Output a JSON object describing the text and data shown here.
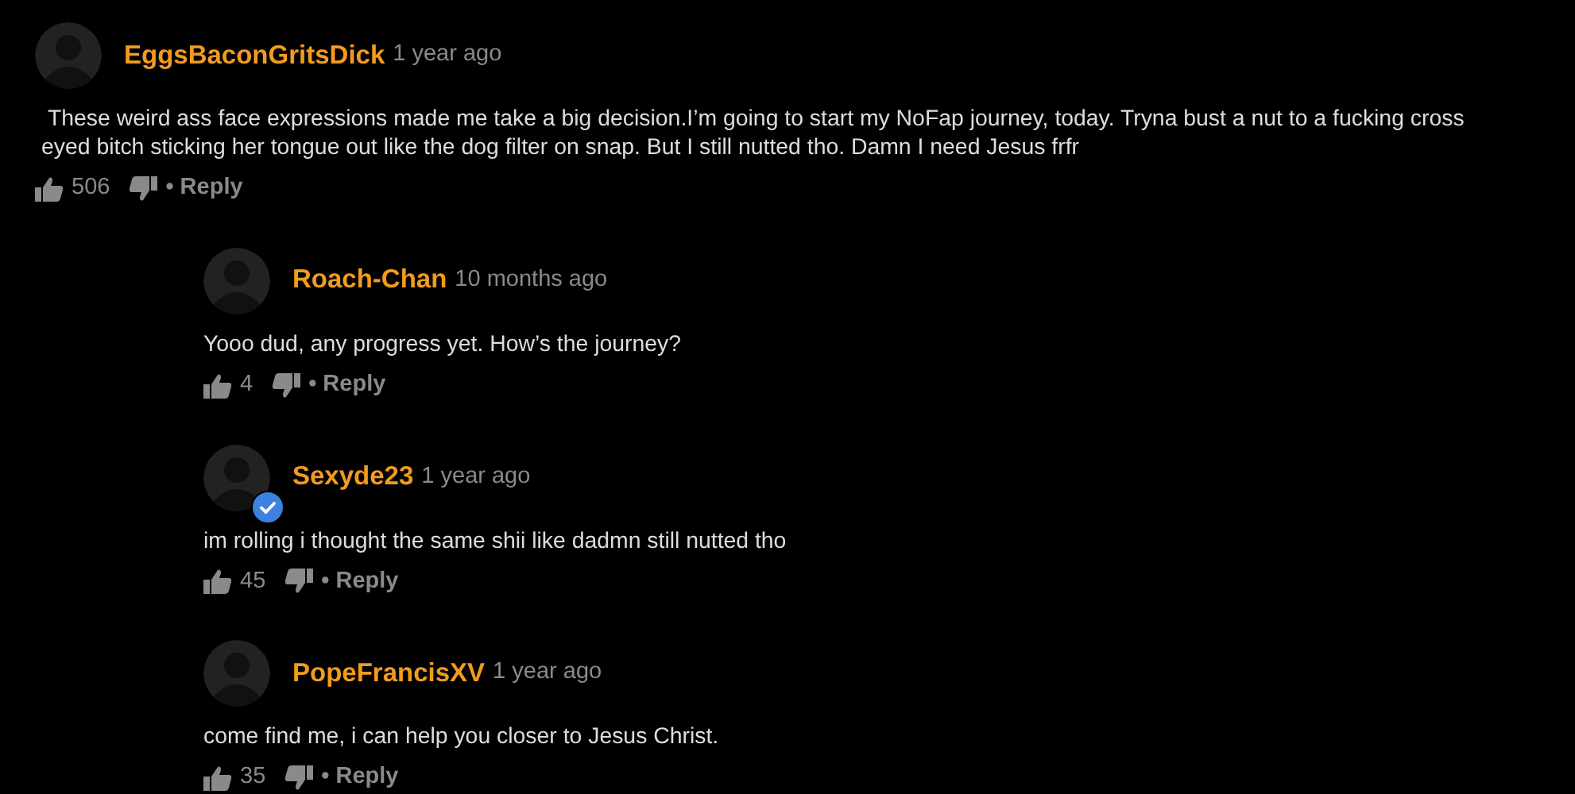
{
  "comment": {
    "author": "EggsBaconGritsDick",
    "time": "1 year ago",
    "verified": false,
    "text": "These weird ass face expressions made me take a big decision.I’m going to start my NoFap journey, today. Tryna bust a nut to a fucking cross eyed bitch sticking her tongue out like the dog filter on snap. But I still nutted tho. Damn I need Jesus frfr",
    "likes": "506",
    "reply_label": "• Reply",
    "replies": [
      {
        "author": "Roach-Chan",
        "time": "10 months ago",
        "verified": false,
        "text": "Yooo dud, any progress yet. How’s the journey?",
        "likes": "4",
        "reply_label": "• Reply"
      },
      {
        "author": "Sexyde23",
        "time": "1 year ago",
        "verified": true,
        "text": "im rolling i thought the same shii like dadmn still nutted tho",
        "likes": "45",
        "reply_label": "• Reply"
      },
      {
        "author": "PopeFrancisXV",
        "time": "1 year ago",
        "verified": false,
        "text": "come find me, i can help you closer to Jesus Christ.",
        "likes": "35",
        "reply_label": "• Reply"
      }
    ]
  }
}
